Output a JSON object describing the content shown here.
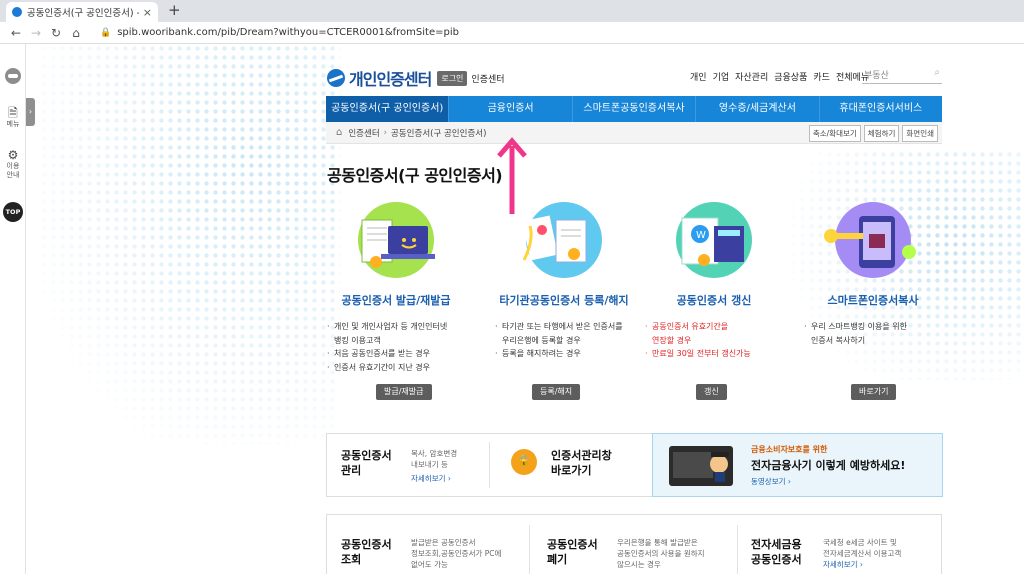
{
  "browser": {
    "tab_title": "공동인증서(구 공인인증서) - 우",
    "tab_close": "×",
    "new_tab": "+",
    "url": "spib.wooribank.com/pib/Dream?withyou=CTCER0001&fromSite=pib"
  },
  "rail": {
    "menu_label": "메뉴",
    "guide_label1": "이용",
    "guide_label2": "안내",
    "top_label": "TOP"
  },
  "header": {
    "logo_text": "개인인증센터",
    "login_label": "로그인",
    "center_label": "인증센터",
    "gnb": [
      "개인",
      "기업",
      "자산관리",
      "금융상품",
      "카드",
      "전체메뉴"
    ],
    "search_placeholder": "부동산"
  },
  "menu": [
    "공동인증서(구 공인인증서)",
    "금융인증서",
    "스마트폰공동인증서복사",
    "영수증/세금계산서",
    "휴대폰인증서서비스"
  ],
  "breadcrumb": {
    "root": "인증센터",
    "current": "공동인증서(구 공인인증서)",
    "tools": [
      "축소/확대보기",
      "체험하기",
      "화면인쇄"
    ]
  },
  "page_title": "공동인증서(구 공인인증서)",
  "services": [
    {
      "title": "공동인증서 발급/재발급",
      "items": [
        {
          "text": "개인 및 개인사업자 등 개인인터넷",
          "red": false
        },
        {
          "text": "뱅킹 이용고객",
          "red": false,
          "cont": true
        },
        {
          "text": "처음 공동인증서를 받는 경우",
          "red": false
        },
        {
          "text": "인증서 유효기간이 지난 경우",
          "red": false
        }
      ],
      "button": "발급/재발급"
    },
    {
      "title": "타기관공동인증서 등록/해지",
      "items": [
        {
          "text": "타기관 또는 타행에서 받은 인증서를",
          "red": false
        },
        {
          "text": "우리은행에 등록할 경우",
          "red": false,
          "cont": true
        },
        {
          "text": "등록을 해지하려는 경우",
          "red": false
        }
      ],
      "button": "등록/해지"
    },
    {
      "title": "공동인증서 갱신",
      "items": [
        {
          "text": "공동인증서 유효기간을",
          "red": true
        },
        {
          "text": "연장할 경우",
          "red": true,
          "cont": true
        },
        {
          "text": "만료일 30일 전부터 갱신가능",
          "red": true
        }
      ],
      "button": "갱신"
    },
    {
      "title": "스마트폰인증서복사",
      "items": [
        {
          "text": "우리 스마트뱅킹 이용을 위한",
          "red": false
        },
        {
          "text": "인증서 복사하기",
          "red": false,
          "cont": true
        }
      ],
      "button": "바로가기"
    }
  ],
  "box1": {
    "manage_title1": "공동인증서",
    "manage_title2": "관리",
    "manage_desc1": "복사, 암호변경",
    "manage_desc2": "내보내기 등",
    "manage_link": "자세히보기 ›",
    "window_title1": "인증서관리창",
    "window_title2": "바로가기",
    "ad_sub": "금융소비자보호를 위한",
    "ad_main": "전자금융사기 이렇게 예방하세요!",
    "ad_link": "동영상보기 ›"
  },
  "box2": [
    {
      "title1": "공동인증서",
      "title2": "조회",
      "desc": [
        "발급받은 공동인증서",
        "정보조회,공동인증서가 PC에",
        "없어도 가능"
      ]
    },
    {
      "title1": "공동인증서",
      "title2": "폐기",
      "desc": [
        "우리은행을 통해 발급받은",
        "공동인증서의 사용을 원하지",
        "않으시는 경우"
      ]
    },
    {
      "title1": "전자세금용",
      "title2": "공동인증서",
      "desc": [
        "국세청 e세금 사이트 및",
        "전자세금계산서 이용고객"
      ],
      "link": "자세히보기 ›"
    }
  ]
}
